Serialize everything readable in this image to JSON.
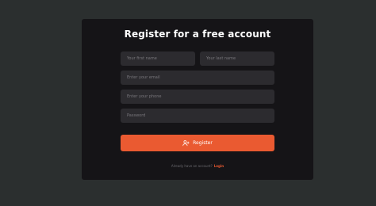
{
  "form": {
    "title": "Register for a free account",
    "first_name_placeholder": "Your first name",
    "last_name_placeholder": "Your last name",
    "email_placeholder": "Enter your email",
    "phone_placeholder": "Enter your phone",
    "password_placeholder": "Password",
    "register_label": "Register",
    "register_icon": "user-plus-icon",
    "footer_text": "Already have an account?",
    "login_label": "Login"
  },
  "colors": {
    "background": "#2b2f2f",
    "card": "#151417",
    "input": "#2c2b2f",
    "accent": "#ea5a31"
  }
}
